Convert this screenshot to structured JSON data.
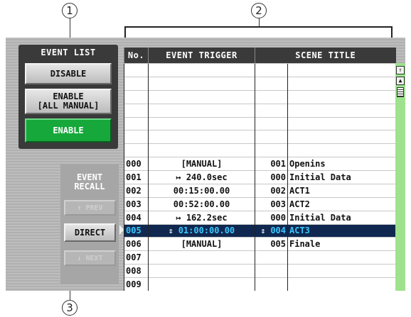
{
  "callouts": {
    "one": "1",
    "two": "2",
    "three": "3"
  },
  "event_list": {
    "title": "EVENT LIST",
    "disable_label": "DISABLE",
    "enable_all_manual_line1": "ENABLE",
    "enable_all_manual_line2": "[ALL MANUAL]",
    "enable_label": "ENABLE"
  },
  "event_recall": {
    "title_line1": "EVENT",
    "title_line2": "RECALL",
    "prev_label": "↑ PREV",
    "direct_label": "DIRECT",
    "next_label": "↓ NEXT"
  },
  "table": {
    "headers": {
      "no": "No.",
      "trigger": "EVENT TRIGGER",
      "scene": "SCENE TITLE"
    },
    "rows": [
      {
        "no": "",
        "trigger": "",
        "scene_no": "",
        "title": ""
      },
      {
        "no": "",
        "trigger": "",
        "scene_no": "",
        "title": ""
      },
      {
        "no": "",
        "trigger": "",
        "scene_no": "",
        "title": ""
      },
      {
        "no": "",
        "trigger": "",
        "scene_no": "",
        "title": ""
      },
      {
        "no": "",
        "trigger": "",
        "scene_no": "",
        "title": ""
      },
      {
        "no": "",
        "trigger": "",
        "scene_no": "",
        "title": ""
      },
      {
        "no": "",
        "trigger": "",
        "scene_no": "",
        "title": ""
      },
      {
        "no": "000",
        "trigger": "[MANUAL]",
        "scene_no": "001",
        "title": "Openins"
      },
      {
        "no": "001",
        "trigger": "↦ 240.0sec",
        "scene_no": "000",
        "title": "Initial Data"
      },
      {
        "no": "002",
        "trigger": "00:15:00.00",
        "scene_no": "002",
        "title": "ACT1"
      },
      {
        "no": "003",
        "trigger": "00:52:00.00",
        "scene_no": "003",
        "title": "ACT2"
      },
      {
        "no": "004",
        "trigger": "↦ 162.2sec",
        "scene_no": "000",
        "title": "Initial Data"
      },
      {
        "no": "005",
        "trigger": "01:00:00.00",
        "scene_no": "004",
        "title": "ACT3",
        "selected": true
      },
      {
        "no": "006",
        "trigger": "[MANUAL]",
        "scene_no": "005",
        "title": "Finale"
      },
      {
        "no": "007",
        "trigger": "",
        "scene_no": "",
        "title": ""
      },
      {
        "no": "008",
        "trigger": "",
        "scene_no": "",
        "title": ""
      },
      {
        "no": "009",
        "trigger": "",
        "scene_no": "",
        "title": ""
      }
    ],
    "selected_marker": "⇕"
  },
  "scrollbar": {
    "top_icon": "double-up",
    "up_icon": "up"
  },
  "colors": {
    "enable_green": "#16a83a",
    "selected_row_bg": "#102850",
    "selected_row_text": "#39c8ff"
  }
}
